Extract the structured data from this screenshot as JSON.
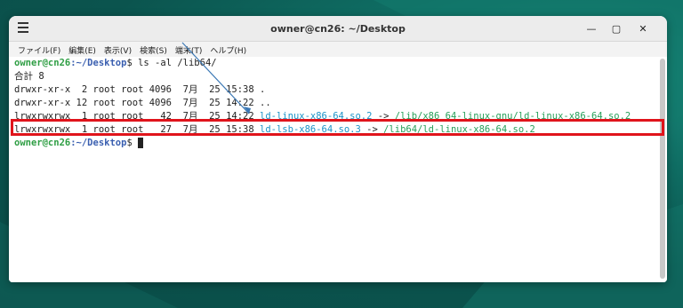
{
  "window": {
    "title": "owner@cn26: ~/Desktop"
  },
  "menu": {
    "items": [
      "ファイル(F)",
      "編集(E)",
      "表示(V)",
      "検索(S)",
      "端末(T)",
      "ヘルプ(H)"
    ]
  },
  "terminal": {
    "prompt_user": "owner@cn26",
    "prompt_path": ":~/Desktop",
    "prompt_symbol": "$ ",
    "command": "ls -al /lib64/",
    "total": "合計 8",
    "rows": [
      {
        "meta": "drwxr-xr-x  2 root root 4096  7月  25 15:38 ",
        "name": ".",
        "target": ""
      },
      {
        "meta": "drwxr-xr-x 12 root root 4096  7月  25 14:22 ",
        "name": "..",
        "target": ""
      },
      {
        "meta": "lrwxrwxrwx  1 root root   42  7月  25 14:22 ",
        "name": "ld-linux-x86-64.so.2",
        "arrow": " -> ",
        "target": "/lib/x86_64-linux-gnu/ld-linux-x86-64.so.2"
      },
      {
        "meta": "lrwxrwxrwx  1 root root   27  7月  25 15:38 ",
        "name": "ld-lsb-x86-64.so.3",
        "arrow": " -> ",
        "target": "/lib64/ld-linux-x86-64.so.2"
      }
    ]
  },
  "colors": {
    "highlight": "#e0141b",
    "desktop_bg": "#0b544e"
  },
  "icons": [
    "hamburger-menu-icon",
    "minimize-icon",
    "maximize-icon",
    "close-icon"
  ]
}
